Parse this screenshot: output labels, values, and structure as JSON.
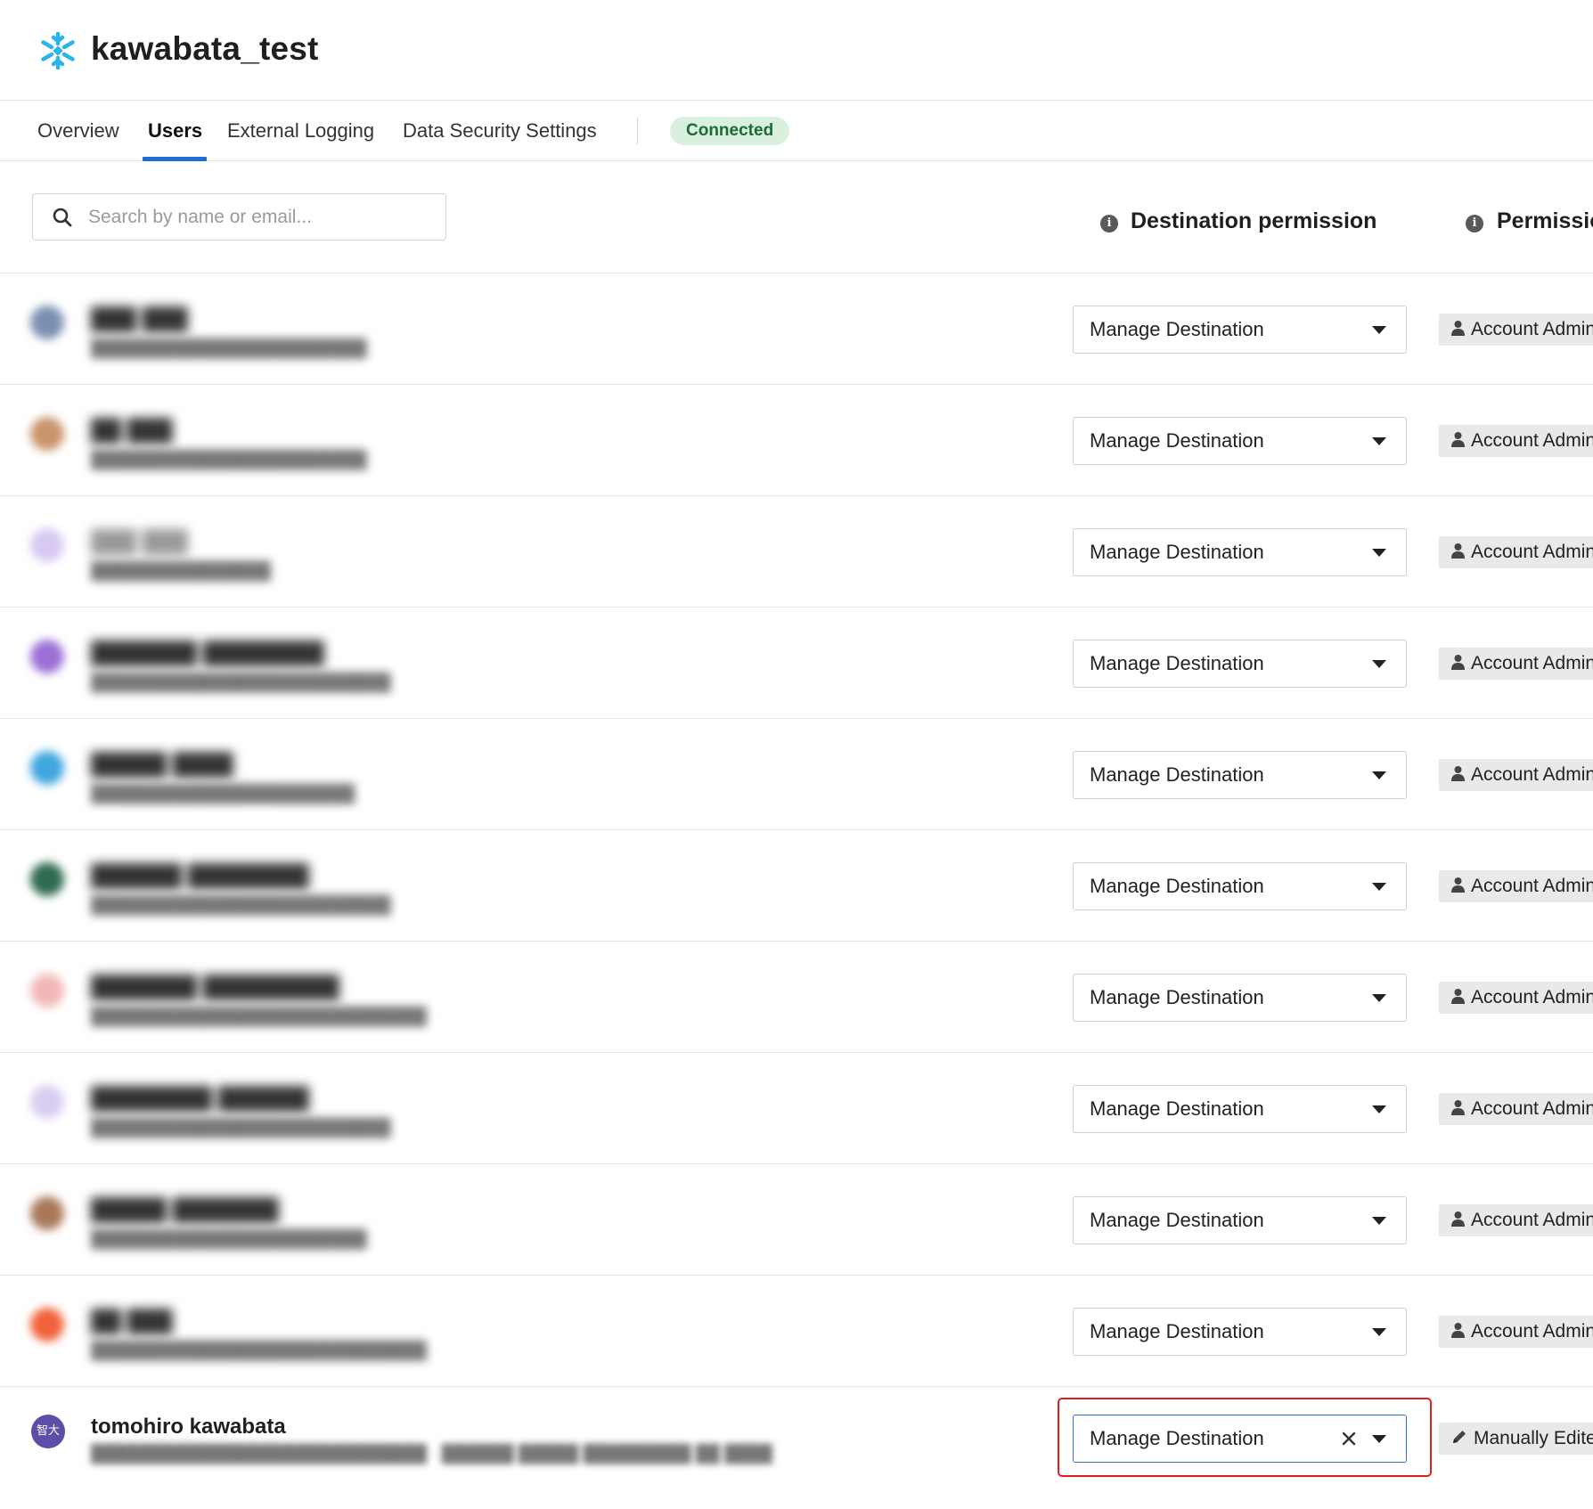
{
  "app": {
    "title": "kawabata_test",
    "logo_icon": "snowflake-icon",
    "accent_color": "#29b5e8"
  },
  "tabs": [
    {
      "label": "Overview",
      "active": false
    },
    {
      "label": "Users",
      "active": true
    },
    {
      "label": "External Logging",
      "active": false
    },
    {
      "label": "Data Security Settings",
      "active": false
    }
  ],
  "status": {
    "label": "Connected",
    "color": "#d8f0dd"
  },
  "search": {
    "placeholder": "Search by name or email..."
  },
  "columns": {
    "destination_permission": "Destination permission",
    "permission": "Permissio"
  },
  "users": [
    {
      "avatar_color": "#7a8fb0",
      "destination_permission": "Manage Destination",
      "permission": "Account Admini"
    },
    {
      "avatar_color": "#c9946b",
      "destination_permission": "Manage Destination",
      "permission": "Account Admini"
    },
    {
      "avatar_color": "#d8c9f2",
      "destination_permission": "Manage Destination",
      "permission": "Account Admini"
    },
    {
      "avatar_color": "#9b6fd6",
      "destination_permission": "Manage Destination",
      "permission": "Account Admini"
    },
    {
      "avatar_color": "#3fa6e0",
      "destination_permission": "Manage Destination",
      "permission": "Account Admini"
    },
    {
      "avatar_color": "#2e6b4f",
      "destination_permission": "Manage Destination",
      "permission": "Account Admini"
    },
    {
      "avatar_color": "#f2b7b7",
      "destination_permission": "Manage Destination",
      "permission": "Account Admini"
    },
    {
      "avatar_color": "#d9cdf2",
      "destination_permission": "Manage Destination",
      "permission": "Account Admini"
    },
    {
      "avatar_color": "#a9785a",
      "destination_permission": "Manage Destination",
      "permission": "Account Admini"
    },
    {
      "avatar_color": "#f0623a",
      "destination_permission": "Manage Destination",
      "permission": "Account Admini"
    }
  ],
  "current_user": {
    "avatar_text": "智大",
    "avatar_color": "#5b4fa8",
    "name": "tomohiro kawabata",
    "destination_permission": "Manage Destination",
    "permission": "Manually Edited"
  }
}
